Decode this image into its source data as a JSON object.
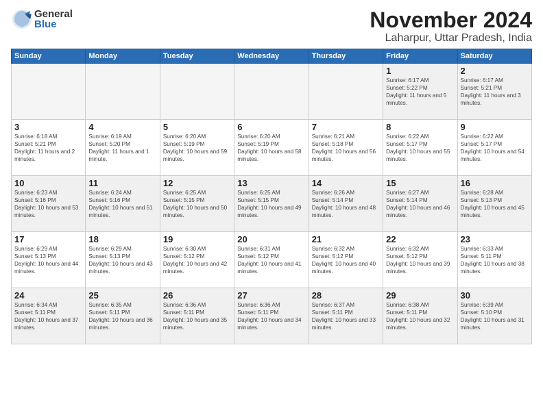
{
  "header": {
    "logo_general": "General",
    "logo_blue": "Blue",
    "title": "November 2024",
    "subtitle": "Laharpur, Uttar Pradesh, India"
  },
  "weekdays": [
    "Sunday",
    "Monday",
    "Tuesday",
    "Wednesday",
    "Thursday",
    "Friday",
    "Saturday"
  ],
  "weeks": [
    [
      {
        "day": "",
        "empty": true
      },
      {
        "day": "",
        "empty": true
      },
      {
        "day": "",
        "empty": true
      },
      {
        "day": "",
        "empty": true
      },
      {
        "day": "",
        "empty": true
      },
      {
        "day": "1",
        "sunrise": "Sunrise: 6:17 AM",
        "sunset": "Sunset: 5:22 PM",
        "daylight": "Daylight: 11 hours and 5 minutes."
      },
      {
        "day": "2",
        "sunrise": "Sunrise: 6:17 AM",
        "sunset": "Sunset: 5:21 PM",
        "daylight": "Daylight: 11 hours and 3 minutes."
      }
    ],
    [
      {
        "day": "3",
        "sunrise": "Sunrise: 6:18 AM",
        "sunset": "Sunset: 5:21 PM",
        "daylight": "Daylight: 11 hours and 2 minutes."
      },
      {
        "day": "4",
        "sunrise": "Sunrise: 6:19 AM",
        "sunset": "Sunset: 5:20 PM",
        "daylight": "Daylight: 11 hours and 1 minute."
      },
      {
        "day": "5",
        "sunrise": "Sunrise: 6:20 AM",
        "sunset": "Sunset: 5:19 PM",
        "daylight": "Daylight: 10 hours and 59 minutes."
      },
      {
        "day": "6",
        "sunrise": "Sunrise: 6:20 AM",
        "sunset": "Sunset: 5:19 PM",
        "daylight": "Daylight: 10 hours and 58 minutes."
      },
      {
        "day": "7",
        "sunrise": "Sunrise: 6:21 AM",
        "sunset": "Sunset: 5:18 PM",
        "daylight": "Daylight: 10 hours and 56 minutes."
      },
      {
        "day": "8",
        "sunrise": "Sunrise: 6:22 AM",
        "sunset": "Sunset: 5:17 PM",
        "daylight": "Daylight: 10 hours and 55 minutes."
      },
      {
        "day": "9",
        "sunrise": "Sunrise: 6:22 AM",
        "sunset": "Sunset: 5:17 PM",
        "daylight": "Daylight: 10 hours and 54 minutes."
      }
    ],
    [
      {
        "day": "10",
        "sunrise": "Sunrise: 6:23 AM",
        "sunset": "Sunset: 5:16 PM",
        "daylight": "Daylight: 10 hours and 53 minutes."
      },
      {
        "day": "11",
        "sunrise": "Sunrise: 6:24 AM",
        "sunset": "Sunset: 5:16 PM",
        "daylight": "Daylight: 10 hours and 51 minutes."
      },
      {
        "day": "12",
        "sunrise": "Sunrise: 6:25 AM",
        "sunset": "Sunset: 5:15 PM",
        "daylight": "Daylight: 10 hours and 50 minutes."
      },
      {
        "day": "13",
        "sunrise": "Sunrise: 6:25 AM",
        "sunset": "Sunset: 5:15 PM",
        "daylight": "Daylight: 10 hours and 49 minutes."
      },
      {
        "day": "14",
        "sunrise": "Sunrise: 6:26 AM",
        "sunset": "Sunset: 5:14 PM",
        "daylight": "Daylight: 10 hours and 48 minutes."
      },
      {
        "day": "15",
        "sunrise": "Sunrise: 6:27 AM",
        "sunset": "Sunset: 5:14 PM",
        "daylight": "Daylight: 10 hours and 46 minutes."
      },
      {
        "day": "16",
        "sunrise": "Sunrise: 6:28 AM",
        "sunset": "Sunset: 5:13 PM",
        "daylight": "Daylight: 10 hours and 45 minutes."
      }
    ],
    [
      {
        "day": "17",
        "sunrise": "Sunrise: 6:29 AM",
        "sunset": "Sunset: 5:13 PM",
        "daylight": "Daylight: 10 hours and 44 minutes."
      },
      {
        "day": "18",
        "sunrise": "Sunrise: 6:29 AM",
        "sunset": "Sunset: 5:13 PM",
        "daylight": "Daylight: 10 hours and 43 minutes."
      },
      {
        "day": "19",
        "sunrise": "Sunrise: 6:30 AM",
        "sunset": "Sunset: 5:12 PM",
        "daylight": "Daylight: 10 hours and 42 minutes."
      },
      {
        "day": "20",
        "sunrise": "Sunrise: 6:31 AM",
        "sunset": "Sunset: 5:12 PM",
        "daylight": "Daylight: 10 hours and 41 minutes."
      },
      {
        "day": "21",
        "sunrise": "Sunrise: 6:32 AM",
        "sunset": "Sunset: 5:12 PM",
        "daylight": "Daylight: 10 hours and 40 minutes."
      },
      {
        "day": "22",
        "sunrise": "Sunrise: 6:32 AM",
        "sunset": "Sunset: 5:12 PM",
        "daylight": "Daylight: 10 hours and 39 minutes."
      },
      {
        "day": "23",
        "sunrise": "Sunrise: 6:33 AM",
        "sunset": "Sunset: 5:11 PM",
        "daylight": "Daylight: 10 hours and 38 minutes."
      }
    ],
    [
      {
        "day": "24",
        "sunrise": "Sunrise: 6:34 AM",
        "sunset": "Sunset: 5:11 PM",
        "daylight": "Daylight: 10 hours and 37 minutes."
      },
      {
        "day": "25",
        "sunrise": "Sunrise: 6:35 AM",
        "sunset": "Sunset: 5:11 PM",
        "daylight": "Daylight: 10 hours and 36 minutes."
      },
      {
        "day": "26",
        "sunrise": "Sunrise: 6:36 AM",
        "sunset": "Sunset: 5:11 PM",
        "daylight": "Daylight: 10 hours and 35 minutes."
      },
      {
        "day": "27",
        "sunrise": "Sunrise: 6:36 AM",
        "sunset": "Sunset: 5:11 PM",
        "daylight": "Daylight: 10 hours and 34 minutes."
      },
      {
        "day": "28",
        "sunrise": "Sunrise: 6:37 AM",
        "sunset": "Sunset: 5:11 PM",
        "daylight": "Daylight: 10 hours and 33 minutes."
      },
      {
        "day": "29",
        "sunrise": "Sunrise: 6:38 AM",
        "sunset": "Sunset: 5:11 PM",
        "daylight": "Daylight: 10 hours and 32 minutes."
      },
      {
        "day": "30",
        "sunrise": "Sunrise: 6:39 AM",
        "sunset": "Sunset: 5:10 PM",
        "daylight": "Daylight: 10 hours and 31 minutes."
      }
    ]
  ],
  "colors": {
    "header_bg": "#2a6db5",
    "shaded_row": "#f0f0f0",
    "empty_cell": "#f5f5f5"
  }
}
